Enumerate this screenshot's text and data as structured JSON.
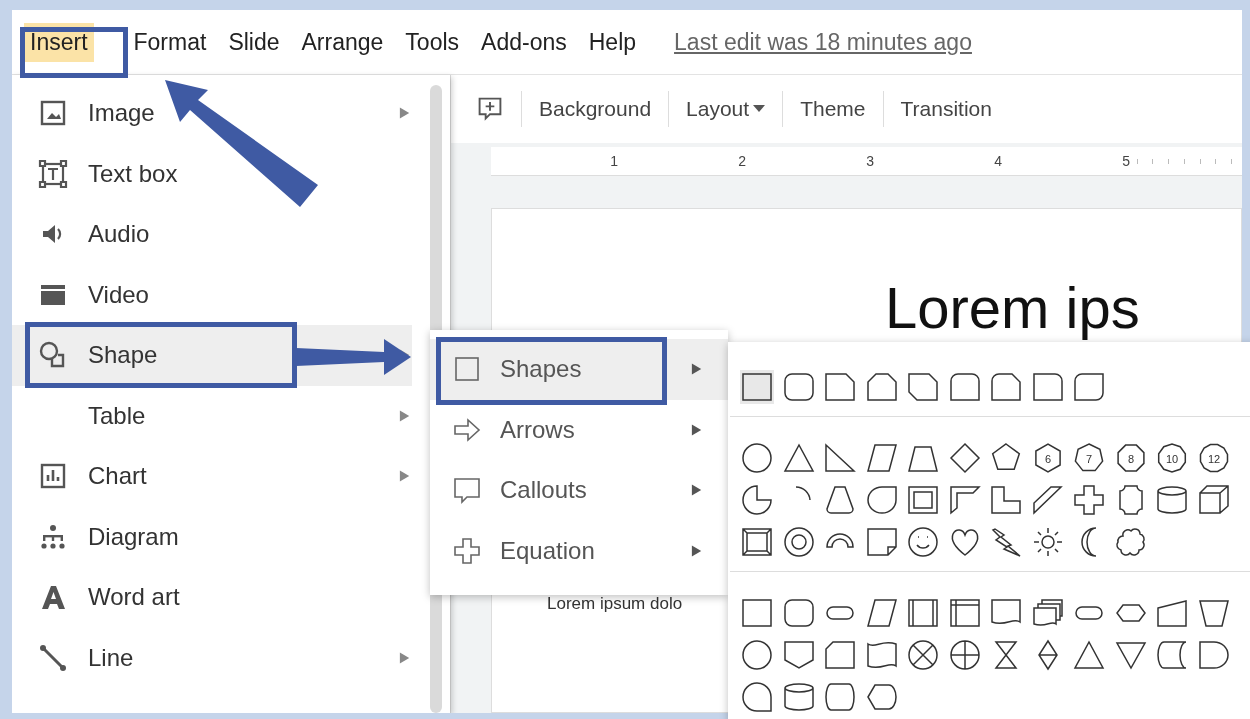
{
  "menu_bar": {
    "items": [
      {
        "label": "Insert",
        "selected": true
      },
      {
        "label": "Format",
        "selected": false
      },
      {
        "label": "Slide",
        "selected": false
      },
      {
        "label": "Arrange",
        "selected": false
      },
      {
        "label": "Tools",
        "selected": false
      },
      {
        "label": "Add-ons",
        "selected": false
      },
      {
        "label": "Help",
        "selected": false
      }
    ],
    "last_edit": "Last edit was 18 minutes ago"
  },
  "toolbar": {
    "buttons": [
      {
        "label": "Background",
        "dropdown": false
      },
      {
        "label": "Layout",
        "dropdown": true
      },
      {
        "label": "Theme",
        "dropdown": false
      },
      {
        "label": "Transition",
        "dropdown": false
      }
    ]
  },
  "ruler": {
    "marks": [
      "1",
      "2",
      "3",
      "4",
      "5"
    ]
  },
  "slide": {
    "title": "Lorem ips",
    "body": "Lorem ipsum dolo"
  },
  "insert_menu": {
    "items": [
      {
        "label": "Image",
        "kind": "image",
        "submenu": true,
        "selected": false
      },
      {
        "label": "Text box",
        "kind": "textbox",
        "submenu": false,
        "selected": false
      },
      {
        "label": "Audio",
        "kind": "audio",
        "submenu": false,
        "selected": false
      },
      {
        "label": "Video",
        "kind": "video",
        "submenu": false,
        "selected": false
      },
      {
        "label": "Shape",
        "kind": "shape",
        "submenu": true,
        "selected": true
      },
      {
        "label": "Table",
        "kind": "table",
        "submenu": true,
        "selected": false
      },
      {
        "label": "Chart",
        "kind": "chart",
        "submenu": true,
        "selected": false
      },
      {
        "label": "Diagram",
        "kind": "diagram",
        "submenu": false,
        "selected": false
      },
      {
        "label": "Word art",
        "kind": "wordart",
        "submenu": false,
        "selected": false
      },
      {
        "label": "Line",
        "kind": "line",
        "submenu": true,
        "selected": false
      }
    ]
  },
  "shape_submenu": {
    "items": [
      {
        "label": "Shapes",
        "kind": "square",
        "selected": true
      },
      {
        "label": "Arrows",
        "kind": "arrow",
        "selected": false
      },
      {
        "label": "Callouts",
        "kind": "callout",
        "selected": false
      },
      {
        "label": "Equation",
        "kind": "plus",
        "selected": false
      }
    ]
  },
  "shapes_palette": {
    "numbered_shapes": [
      "6",
      "7",
      "8",
      "10",
      "12"
    ]
  }
}
